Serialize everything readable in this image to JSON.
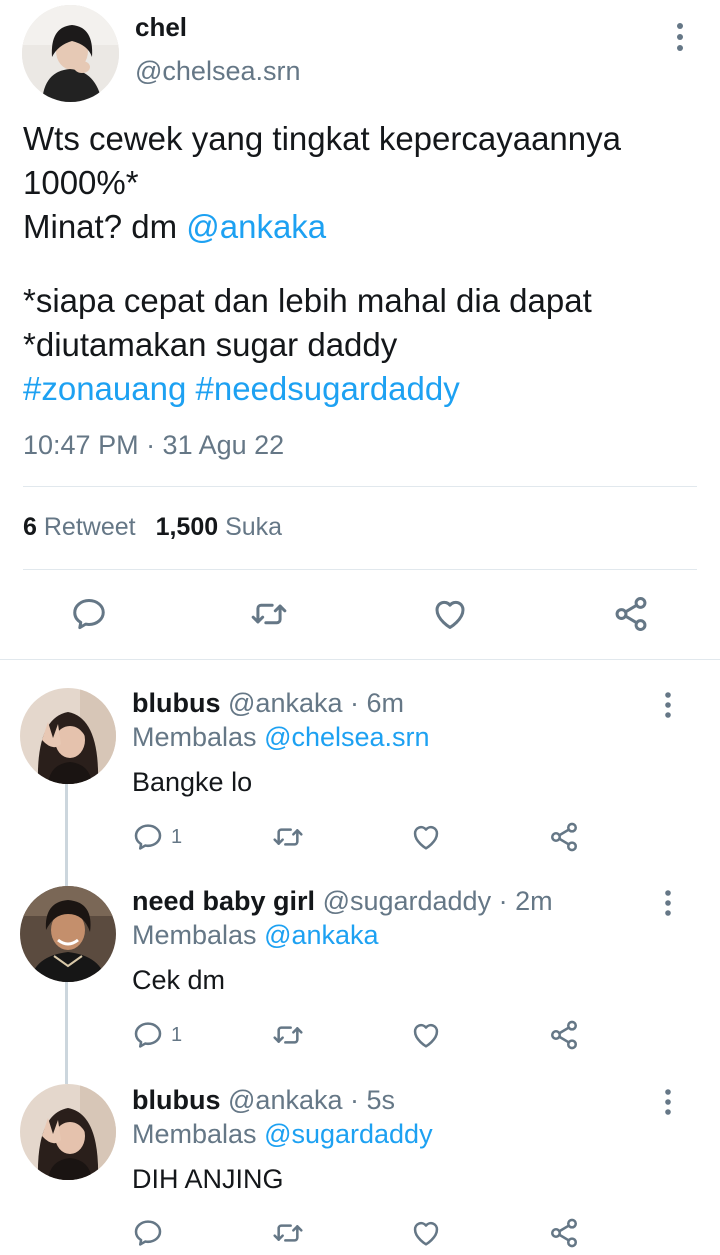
{
  "tweet": {
    "author_name": "chel",
    "author_handle": "@chelsea.srn",
    "text_lines": [
      "Wts cewek yang tingkat kepercayaannya",
      "1000%*"
    ],
    "text_prefix_3": "Minat? dm ",
    "mention": "@ankaka",
    "text_lines_2": [
      "*siapa cepat dan lebih mahal dia dapat",
      "*diutamakan sugar daddy"
    ],
    "hashtags": [
      "#zonauang",
      "#needsugardaddy"
    ],
    "timestamp": "10:47 PM · 31 Agu 22",
    "retweet_count": "6",
    "retweet_label": "Retweet",
    "like_count": "1,500",
    "like_label": "Suka"
  },
  "replies": [
    {
      "name": "blubus",
      "meta": "@ankaka · 6m",
      "replying_label": "Membalas",
      "replying_to": "@chelsea.srn",
      "text": "Bangke lo",
      "reply_count": "1"
    },
    {
      "name": "need baby girl",
      "meta": "@sugardaddy · 2m",
      "replying_label": "Membalas",
      "replying_to": "@ankaka",
      "text": "Cek dm",
      "reply_count": "1"
    },
    {
      "name": "blubus",
      "meta": "@ankaka · 5s",
      "replying_label": "Membalas",
      "replying_to": "@sugardaddy",
      "text": "DIH ANJING",
      "reply_count": ""
    }
  ],
  "icons": {
    "reply": "reply-icon",
    "retweet": "retweet-icon",
    "like": "heart-icon",
    "share": "share-icon",
    "more": "more-vertical-icon"
  },
  "colors": {
    "link": "#1da1f2",
    "secondary_text": "#657786",
    "primary_text": "#14171a",
    "divider": "#e1e8ed"
  }
}
